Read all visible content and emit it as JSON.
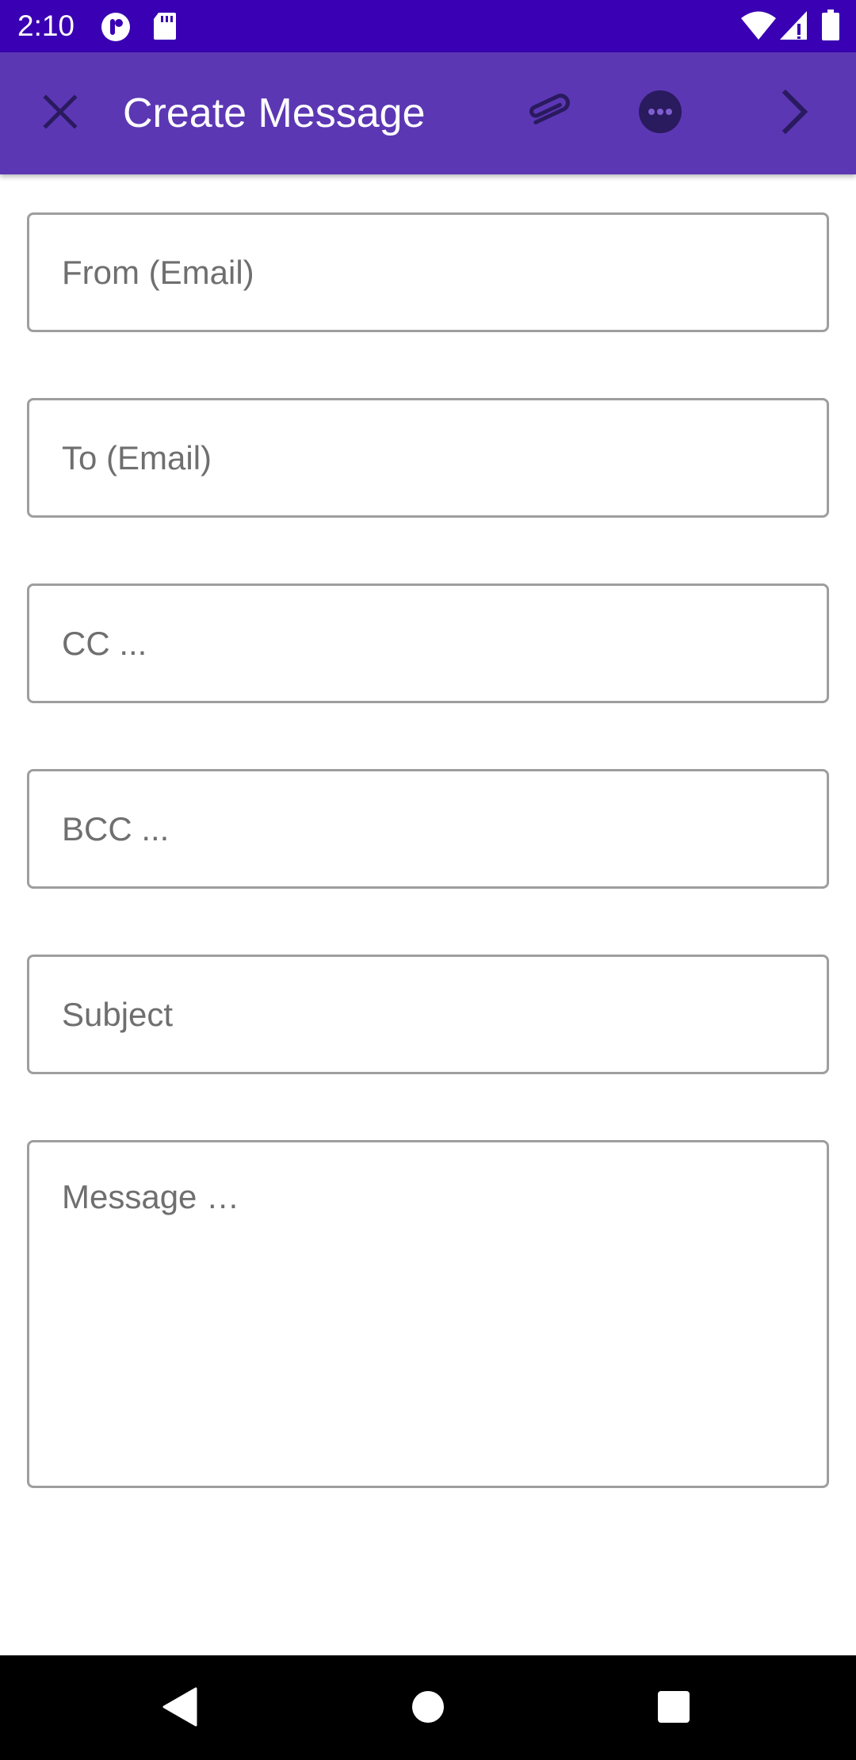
{
  "status_bar": {
    "time": "2:10",
    "icons": [
      "notification-app-icon",
      "sd-card-icon",
      "wifi-icon",
      "signal-icon",
      "battery-icon"
    ]
  },
  "app_bar": {
    "title": "Create Message",
    "actions": [
      "close-icon",
      "attach-icon",
      "more-options-icon",
      "send-next-icon"
    ]
  },
  "form": {
    "from_placeholder": "From (Email)",
    "to_placeholder": "To (Email)",
    "cc_placeholder": "CC ...",
    "bcc_placeholder": "BCC ...",
    "subject_placeholder": "Subject",
    "message_placeholder": "Message …",
    "from_value": "",
    "to_value": "",
    "cc_value": "",
    "bcc_value": "",
    "subject_value": "",
    "message_value": ""
  },
  "navigation_bar": {
    "buttons": [
      "back-icon",
      "home-icon",
      "recents-icon"
    ]
  },
  "colors": {
    "status_bar": "#3a00b3",
    "app_bar": "#5c37b4",
    "icon_dark": "#2a1a5e",
    "field_border": "#9e9e9e",
    "placeholder": "#6f6f6f"
  }
}
